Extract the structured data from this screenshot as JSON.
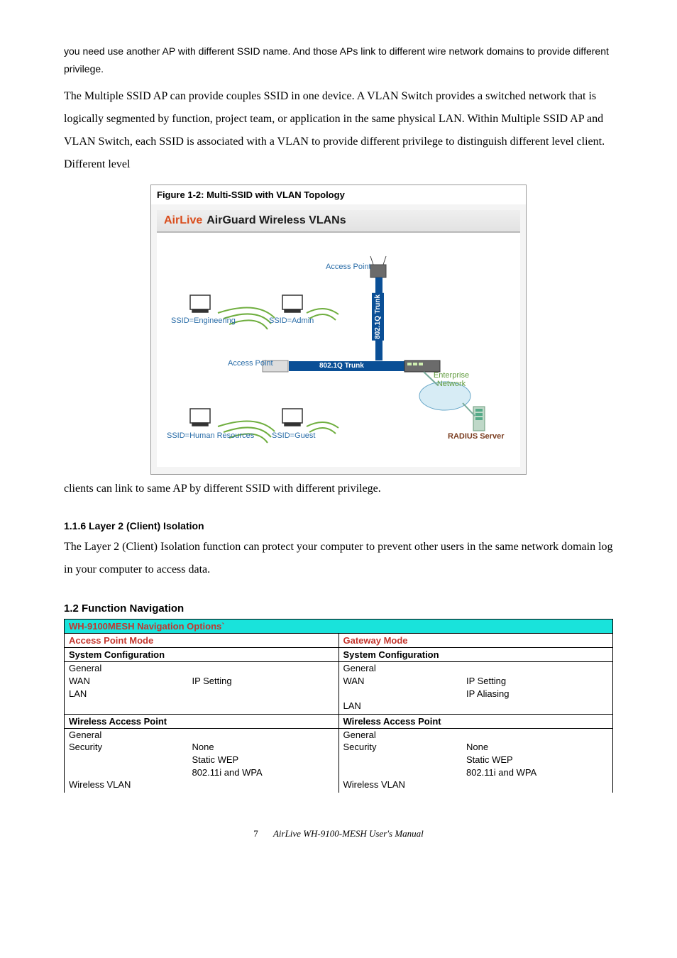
{
  "para1": "you need use another AP with different SSID name. And those APs link to different wire network domains to provide different privilege.",
  "para2": "The Multiple SSID AP can provide couples SSID in one device. A VLAN Switch provides a switched network that is logically segmented by function, project team, or application in the same physical LAN. Within Multiple SSID AP and VLAN Switch, each SSID is associated with a VLAN to provide different privilege to distinguish different level client. Different level",
  "figure": {
    "caption": "Figure 1-2: Multi-SSID with VLAN Topology",
    "logo_left": "AirLive",
    "title": "AirGuard Wireless VLANs",
    "labels": {
      "ap_top": "Access Point",
      "ap_mid": "Access Point",
      "ssid_eng": "SSID=Engineering",
      "ssid_admin": "SSID=Admin",
      "ssid_hr": "SSID=Human Resources",
      "ssid_guest": "SSID=Guest",
      "trunk_h": "802.1Q Trunk",
      "trunk_v": "802.1Q Trunk",
      "enterprise": "Enterprise Network",
      "radius": "RADIUS Server"
    }
  },
  "para3": "clients can link to same AP by different SSID with different privilege.",
  "sec116_title": "1.1.6 Layer 2 (Client) Isolation",
  "sec116_body": "The Layer 2 (Client) Isolation function can protect your computer to prevent other users in the same network domain log in your computer to access data.",
  "sec12_title": "1.2 Function Navigation",
  "table": {
    "header": "WH-9100MESH Navigation Options`",
    "mode_left": "Access Point Mode",
    "mode_right": "Gateway Mode",
    "sysconf": "System Configuration",
    "left_sys": {
      "l1": "General",
      "l2a": "WAN",
      "l2b": "IP Setting",
      "l3": "LAN"
    },
    "right_sys": {
      "l1": "General",
      "l2a": "WAN",
      "l2b": "IP Setting",
      "l2c": "IP Aliasing",
      "l3": "LAN"
    },
    "wap": "Wireless Access Point",
    "left_wap": {
      "l1": "General",
      "l2a": "Security",
      "l2b": "None",
      "l2c": "Static WEP",
      "l2d": "802.11i and WPA",
      "l3": "Wireless VLAN"
    },
    "right_wap": {
      "l1": "General",
      "l2a": "Security",
      "l2b": "None",
      "l2c": "Static WEP",
      "l2d": "802.11i and WPA",
      "l3": "Wireless VLAN"
    }
  },
  "footer": {
    "page": "7",
    "manual": "AirLive WH-9100-MESH User's Manual"
  }
}
